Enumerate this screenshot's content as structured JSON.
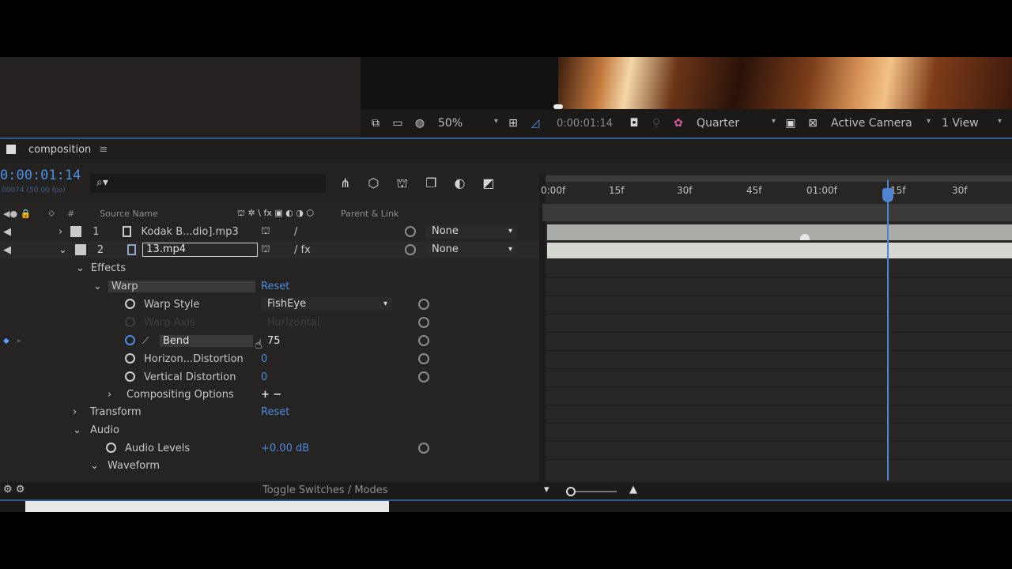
{
  "viewer": {
    "zoom": "50%",
    "timecode": "0:00:01:14",
    "resolution": "Quarter",
    "camera": "Active Camera",
    "views": "1 View"
  },
  "composition": {
    "tab_name": "composition",
    "timecode": "0:00:01:14",
    "timecode_sub": "00074 (50.00 fps)",
    "search_placeholder": "⌕▾"
  },
  "columns": {
    "source_name": "Source Name",
    "parent_link": "Parent & Link",
    "hash": "#"
  },
  "layers": [
    {
      "num": "1",
      "name": "Kodak B...dio].mp3",
      "parent": "None"
    },
    {
      "num": "2",
      "name": "13.mp4",
      "parent": "None"
    }
  ],
  "properties": {
    "effects": "Effects",
    "warp": "Warp",
    "warp_reset": "Reset",
    "warp_style_label": "Warp Style",
    "warp_style_value": "FishEye",
    "warp_axis_label": "Warp Axis",
    "warp_axis_value": "Horizontal",
    "bend_label": "Bend",
    "bend_value": "75",
    "horizon_label": "Horizon...Distortion",
    "horizon_value": "0",
    "vertical_label": "Vertical Distortion",
    "vertical_value": "0",
    "compositing_label": "Compositing Options",
    "compositing_value": "+ −",
    "transform_label": "Transform",
    "transform_reset": "Reset",
    "audio_label": "Audio",
    "audio_levels_label": "Audio Levels",
    "audio_levels_value": "+0.00 dB",
    "waveform_label": "Waveform"
  },
  "ruler": [
    "0:00f",
    "15f",
    "30f",
    "45f",
    "01:00f",
    "15f",
    "30f"
  ],
  "bottom": {
    "toggle": "Toggle Switches / Modes"
  },
  "colors": {
    "accent": "#4c8ae0",
    "panel": "#232221",
    "layer_bar": "#b8bdb5"
  }
}
